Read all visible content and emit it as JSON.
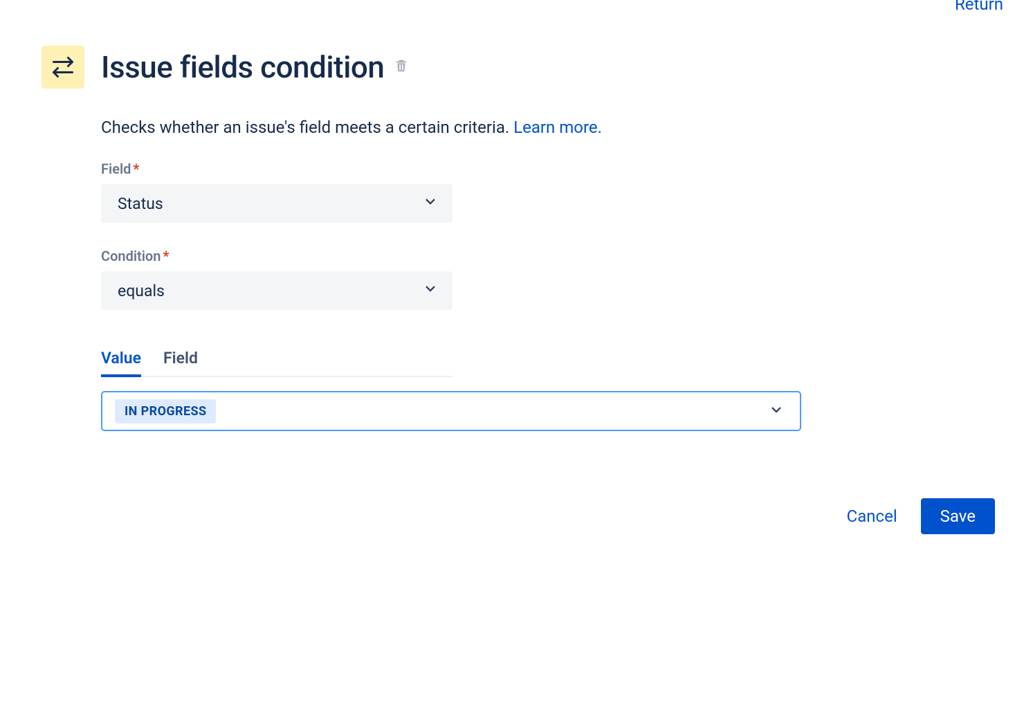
{
  "topRightLink": "Return",
  "title": "Issue fields condition",
  "description": "Checks whether an issue's field meets a certain criteria.",
  "learnMore": "Learn more.",
  "fieldLabel": "Field",
  "fieldValue": "Status",
  "conditionLabel": "Condition",
  "conditionValue": "equals",
  "tabs": {
    "value": "Value",
    "field": "Field"
  },
  "selectedStatus": "IN PROGRESS",
  "cancel": "Cancel",
  "save": "Save",
  "requiredMark": "*"
}
